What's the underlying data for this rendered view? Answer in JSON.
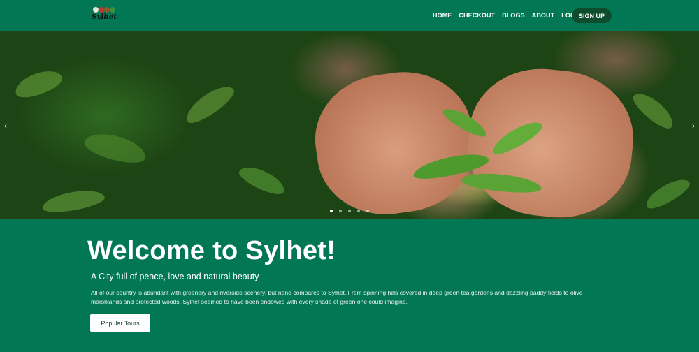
{
  "brand": {
    "logo_text": "Sylhet",
    "ball_colors": [
      "#e8e3d8",
      "#c0392b",
      "#8c5a2b",
      "#3f8f3a"
    ]
  },
  "nav": {
    "items": [
      {
        "label": "HOME",
        "active": true
      },
      {
        "label": "CHECKOUT",
        "active": false
      },
      {
        "label": "BLOGS",
        "active": false
      },
      {
        "label": "ABOUT",
        "active": false
      },
      {
        "label": "LOGIN",
        "active": false
      }
    ],
    "signup_label": "SIGN UP"
  },
  "hero": {
    "prev_icon": "chevron-left-icon",
    "next_icon": "chevron-right-icon",
    "slide_count": 5,
    "active_slide": 1
  },
  "content": {
    "title": "Welcome to Sylhet!",
    "subtitle": "A City full of peace, love and natural beauty",
    "description": "All of our country is abundant with greenery and riverside scenery, but none compares to Sylhet. From spinning hills covered in deep green tea gardens and dazzling paddy fields to olive marshlands and protected woods, Sylhet seemed to have been endowed with every shade of green one could imagine.",
    "cta_label": "Popular Tours"
  },
  "colors": {
    "primary": "#027753",
    "nav_active": "#c9f24b",
    "signup_bg": "#0d4c2c"
  }
}
